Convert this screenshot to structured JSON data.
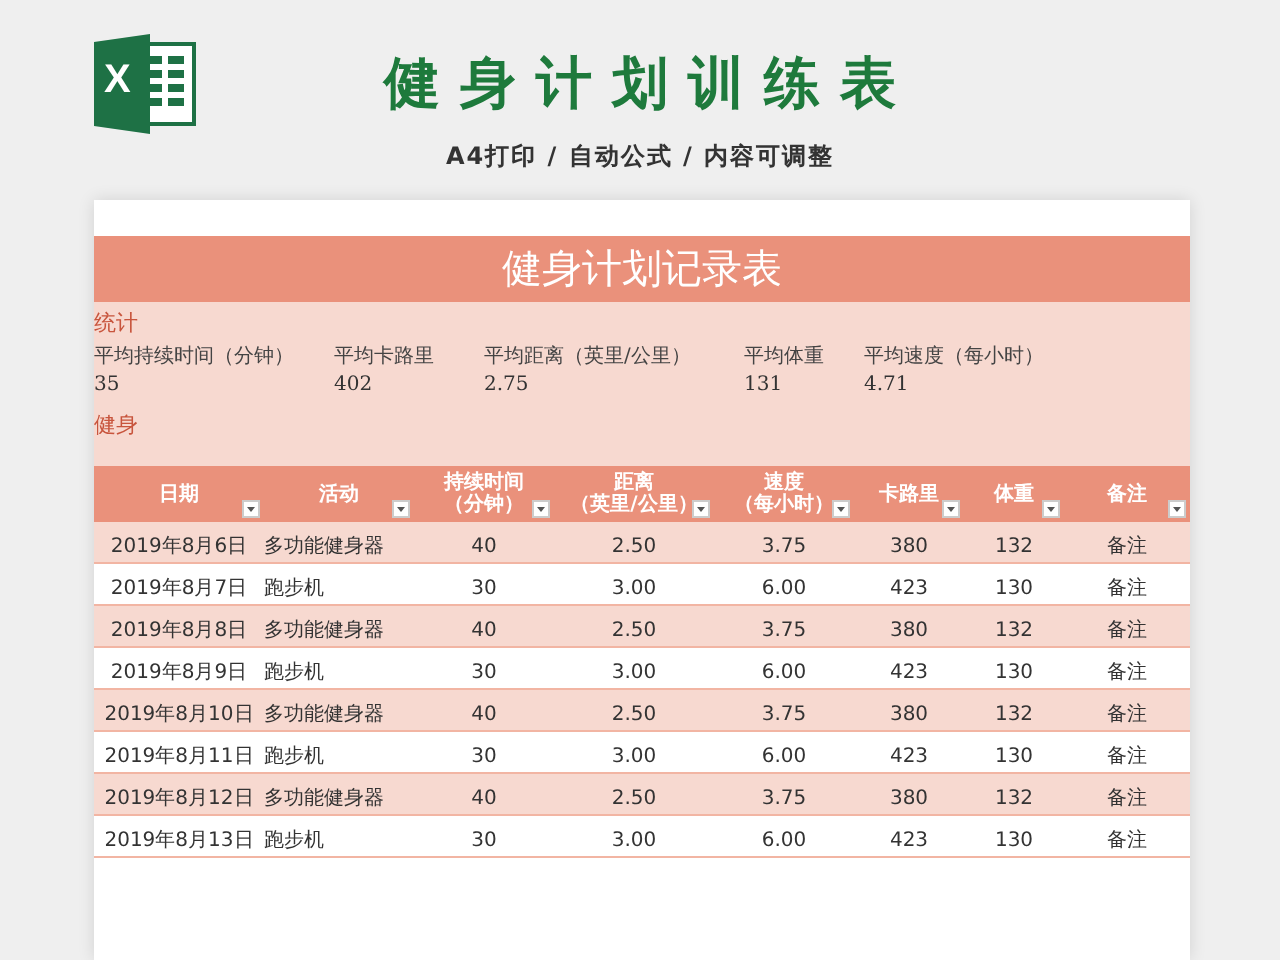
{
  "banner": {
    "logo_letter": "X",
    "title": "健身计划训练表",
    "subtitle": "A4打印 / 自动公式 / 内容可调整"
  },
  "sheet": {
    "title": "健身计划记录表",
    "stats_heading": "统计",
    "stats": [
      {
        "label": "平均持续时间（分钟）",
        "value": "35"
      },
      {
        "label": "平均卡路里",
        "value": "402"
      },
      {
        "label": "平均距离（英里/公里）",
        "value": "2.75"
      },
      {
        "label": "平均体重",
        "value": "131"
      },
      {
        "label": "平均速度（每小时）",
        "value": "4.71"
      }
    ],
    "table_heading": "健身",
    "columns": [
      {
        "lines": [
          "日期"
        ]
      },
      {
        "lines": [
          "活动"
        ]
      },
      {
        "lines": [
          "持续时间",
          "（分钟）"
        ]
      },
      {
        "lines": [
          "距离",
          "（英里/公里）"
        ]
      },
      {
        "lines": [
          "速度",
          "（每小时）"
        ]
      },
      {
        "lines": [
          "卡路里"
        ]
      },
      {
        "lines": [
          "体重"
        ]
      },
      {
        "lines": [
          "备注"
        ]
      }
    ],
    "rows": [
      [
        "2019年8月6日",
        "多功能健身器",
        "40",
        "2.50",
        "3.75",
        "380",
        "132",
        "备注"
      ],
      [
        "2019年8月7日",
        "跑步机",
        "30",
        "3.00",
        "6.00",
        "423",
        "130",
        "备注"
      ],
      [
        "2019年8月8日",
        "多功能健身器",
        "40",
        "2.50",
        "3.75",
        "380",
        "132",
        "备注"
      ],
      [
        "2019年8月9日",
        "跑步机",
        "30",
        "3.00",
        "6.00",
        "423",
        "130",
        "备注"
      ],
      [
        "2019年8月10日",
        "多功能健身器",
        "40",
        "2.50",
        "3.75",
        "380",
        "132",
        "备注"
      ],
      [
        "2019年8月11日",
        "跑步机",
        "30",
        "3.00",
        "6.00",
        "423",
        "130",
        "备注"
      ],
      [
        "2019年8月12日",
        "多功能健身器",
        "40",
        "2.50",
        "3.75",
        "380",
        "132",
        "备注"
      ],
      [
        "2019年8月13日",
        "跑步机",
        "30",
        "3.00",
        "6.00",
        "423",
        "130",
        "备注"
      ]
    ]
  }
}
